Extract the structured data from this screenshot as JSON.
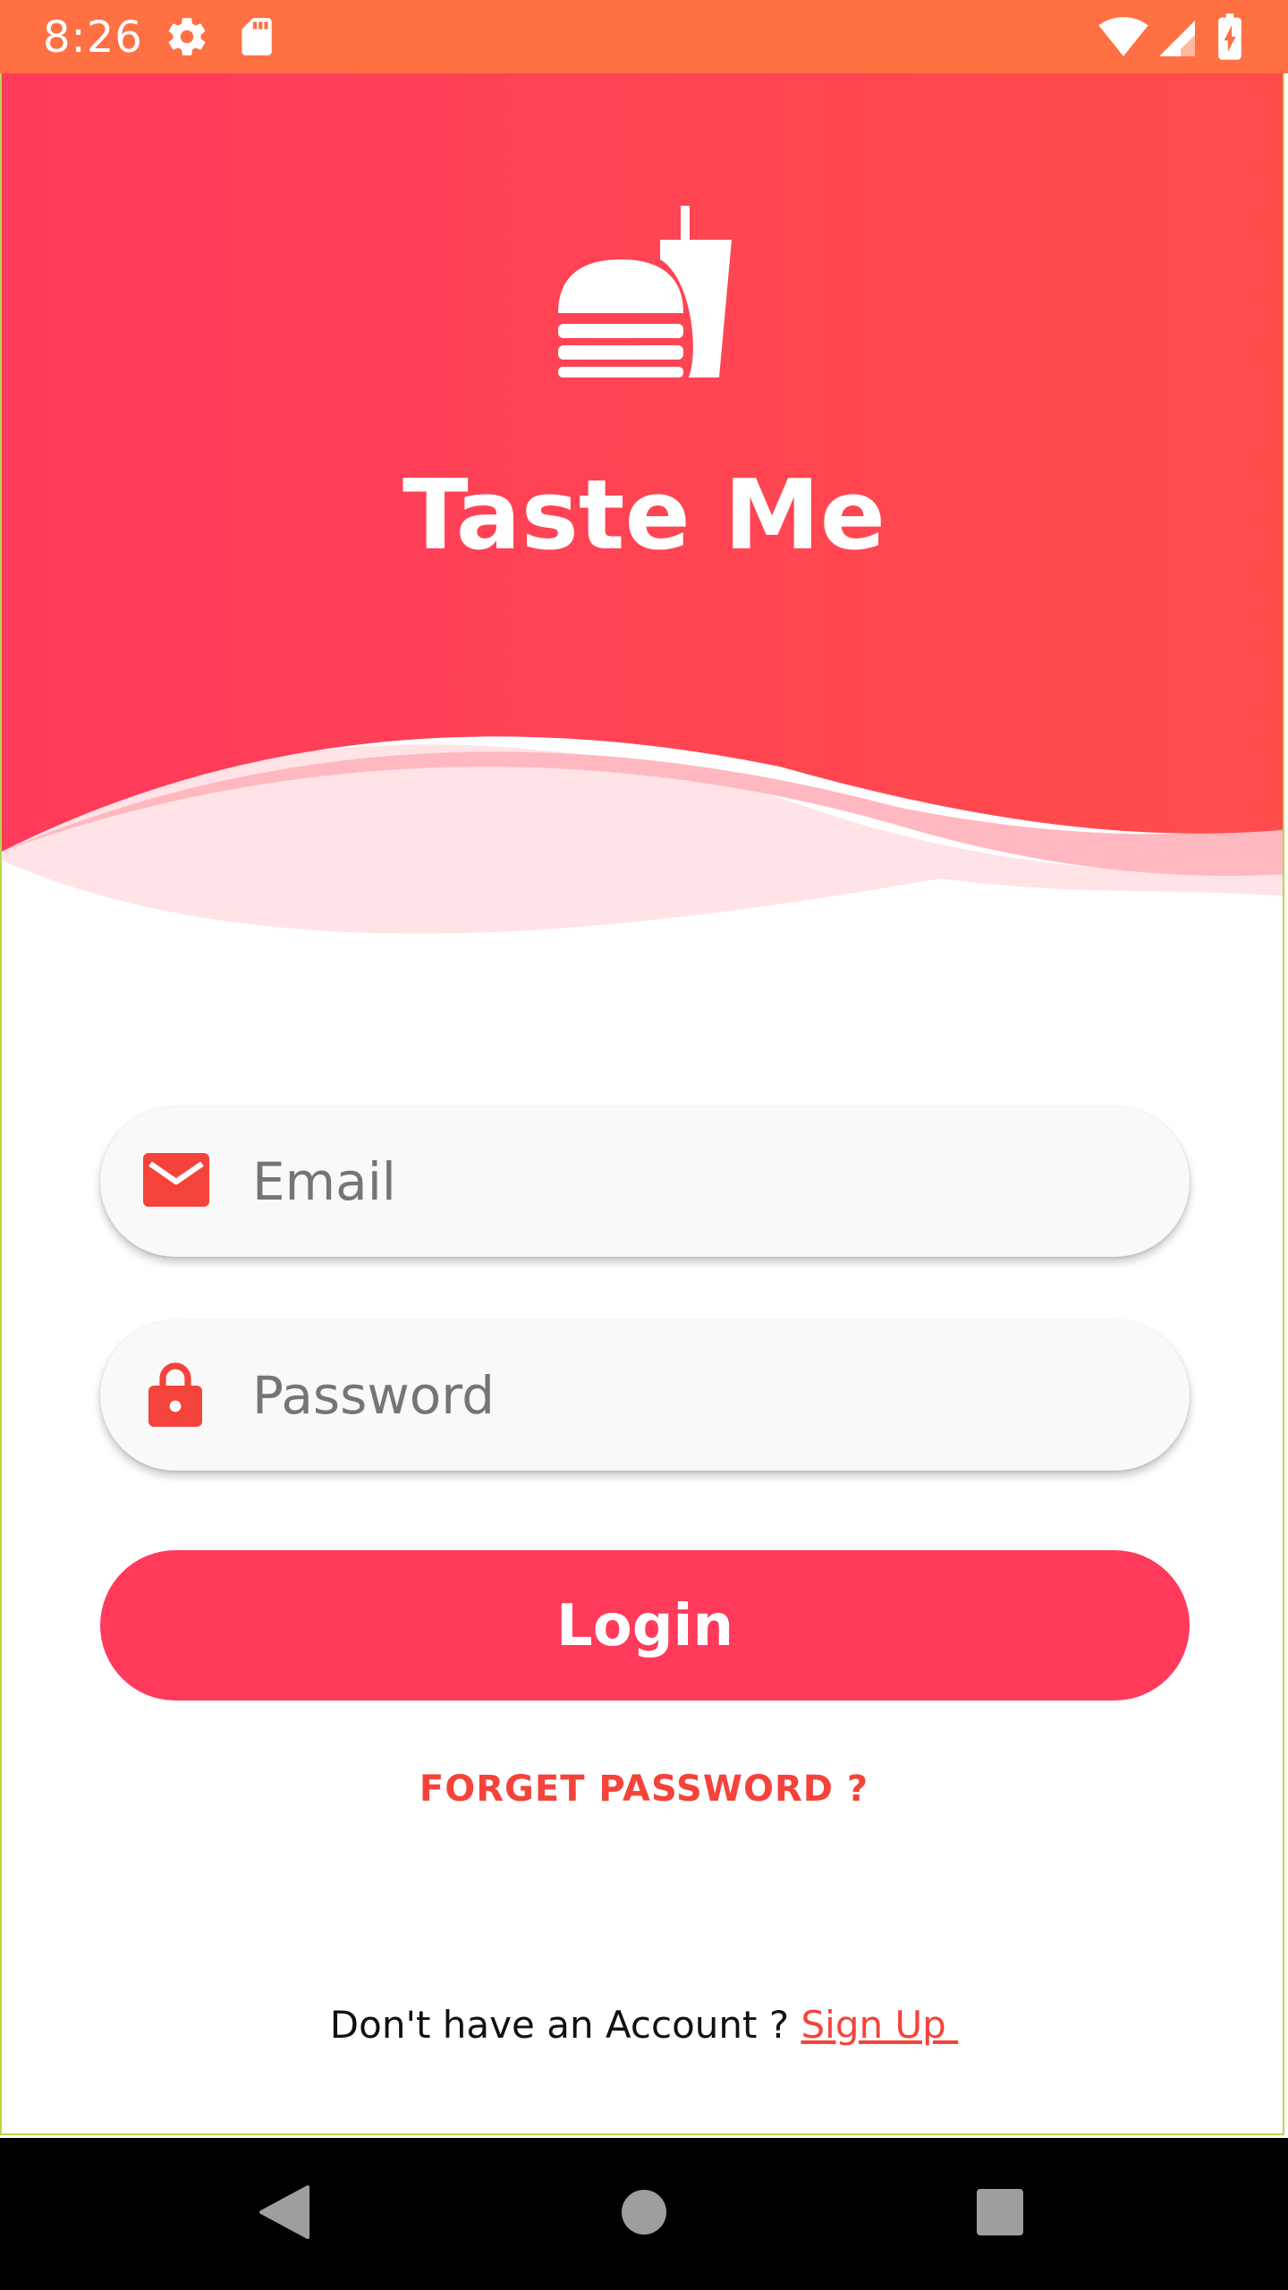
{
  "status_bar": {
    "time": "8:26",
    "icons": [
      "settings-icon",
      "sd-card-icon",
      "wifi-icon",
      "signal-icon",
      "battery-charging-icon"
    ]
  },
  "header": {
    "app_title": "Taste Me",
    "logo_icon": "burger-drink-icon",
    "gradient_start": "#ff3a5b",
    "gradient_end": "#ff4d4b"
  },
  "form": {
    "email": {
      "placeholder": "Email",
      "value": "",
      "icon": "mail-icon"
    },
    "password": {
      "placeholder": "Password",
      "value": "",
      "icon": "lock-icon"
    },
    "login_label": "Login",
    "forget_password_label": "FORGET PASSWORD ?"
  },
  "footer": {
    "prompt": "Don't have an Account ? ",
    "signup_label": "Sign Up "
  },
  "colors": {
    "status_bar": "#ff7043",
    "accent": "#ff3a5b",
    "link": "#f4433a",
    "icon_red": "#f4433a"
  },
  "nav_bar": {
    "buttons": [
      "back-icon",
      "home-icon",
      "recents-icon"
    ]
  }
}
